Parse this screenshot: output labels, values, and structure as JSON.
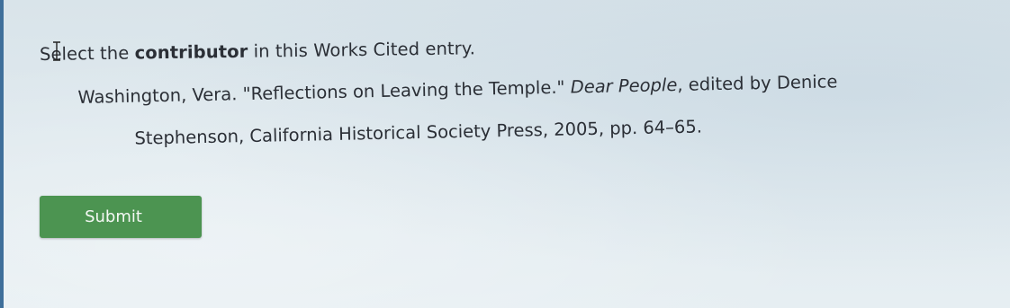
{
  "question": {
    "prefix": "Select the ",
    "emphasis": "contributor",
    "suffix": " in this Works Cited entry."
  },
  "citation": {
    "part1": "Washington, Vera. \"Reflections on Leaving the Temple.\" ",
    "title_italic": "Dear People",
    "part2": ", edited by Denice",
    "line2": "Stephenson, California Historical Society Press, 2005, pp. 64–65."
  },
  "submit_label": "Submit",
  "colors": {
    "submit_button": "#4c9451",
    "background": "#dfe9ee"
  },
  "icons": {
    "text_cursor": "text-cursor-icon"
  }
}
